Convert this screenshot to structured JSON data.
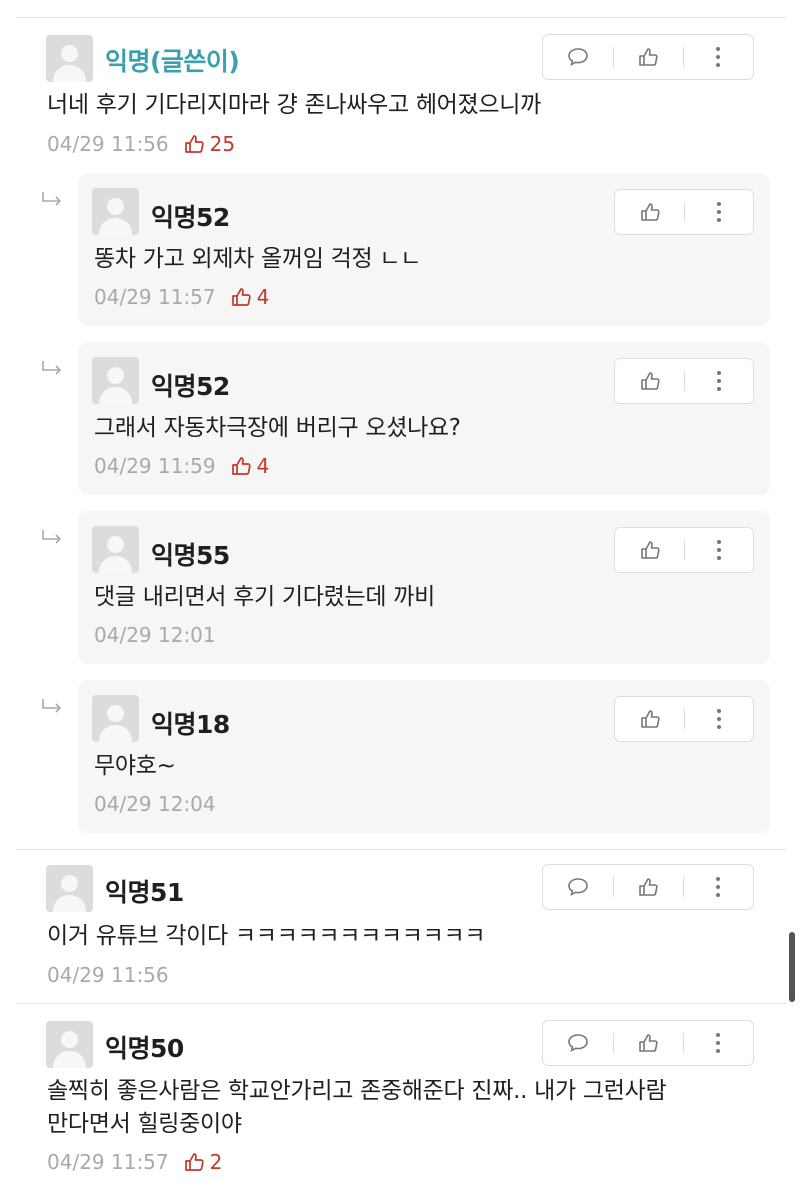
{
  "comments": [
    {
      "author": "익명(글쓴이)",
      "text": "너네 후기 기다리지마라 걍 존나싸우고 헤어졌으니까",
      "time": "04/29 11:56",
      "likes": "25"
    },
    {
      "author": "익명51",
      "text": "이거 유튜브 각이다 ㅋㅋㅋㅋㅋㅋㅋㅋㅋㅋㅋㅋ",
      "time": "04/29 11:56",
      "likes": ""
    },
    {
      "author": "익명50",
      "text_lines": [
        "솔찍히 좋은사람은 학교안가리고 존중해준다 진짜.. 내가 그런사람",
        "만다면서 힐링중이야"
      ],
      "time": "04/29 11:57",
      "likes": "2"
    }
  ],
  "replies": [
    {
      "author": "익명52",
      "text": "똥차 가고 외제차 올꺼임 걱정 ㄴㄴ",
      "time": "04/29 11:57",
      "likes": "4"
    },
    {
      "author": "익명52",
      "text": "그래서 자동차극장에 버리구 오셨나요?",
      "time": "04/29 11:59",
      "likes": "4"
    },
    {
      "author": "익명55",
      "text": "댓글 내리면서 후기 기다렸는데 까비",
      "time": "04/29 12:01",
      "likes": ""
    },
    {
      "author": "익명18",
      "text": "무야호~",
      "time": "04/29 12:04",
      "likes": ""
    }
  ],
  "colors": {
    "op_author": "#3aa0ad",
    "like_count": "#c0392b",
    "meta": "#a9a9a9",
    "reply_bg": "#f6f6f6"
  },
  "icons": {
    "reply": "speech-bubble-icon",
    "like": "thumbs-up-icon",
    "more": "vertical-dots-icon",
    "nested": "reply-arrow-icon"
  }
}
